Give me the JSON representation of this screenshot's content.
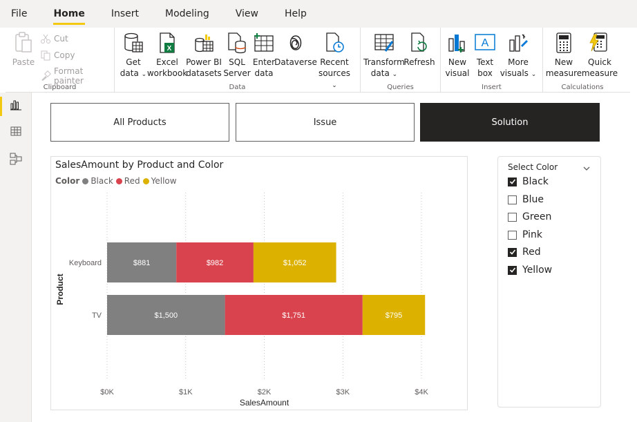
{
  "menu": [
    "File",
    "Home",
    "Insert",
    "Modeling",
    "View",
    "Help"
  ],
  "ribbon": {
    "clipboard": {
      "label": "Clipboard",
      "paste": "Paste",
      "cut": "Cut",
      "copy": "Copy",
      "format_painter": "Format painter"
    },
    "data": {
      "label": "Data",
      "get_data": [
        "Get",
        "data"
      ],
      "excel": [
        "Excel",
        "workbook"
      ],
      "powerbi": [
        "Power BI",
        "datasets"
      ],
      "sql": [
        "SQL",
        "Server"
      ],
      "enter": [
        "Enter",
        "data"
      ],
      "dataverse": [
        "Dataverse",
        ""
      ],
      "recent": [
        "Recent",
        "sources"
      ]
    },
    "queries": {
      "label": "Queries",
      "transform": [
        "Transform",
        "data"
      ],
      "refresh": [
        "Refresh",
        ""
      ]
    },
    "insert": {
      "label": "Insert",
      "new_visual": [
        "New",
        "visual"
      ],
      "text_box": [
        "Text",
        "box"
      ],
      "more_visuals": [
        "More",
        "visuals"
      ]
    },
    "calculations": {
      "label": "Calculations",
      "new_measure": [
        "New",
        "measure"
      ],
      "quick_measure": [
        "Quick",
        "measure"
      ]
    }
  },
  "tabs": [
    {
      "label": "All Products",
      "selected": false
    },
    {
      "label": "Issue",
      "selected": false
    },
    {
      "label": "Solution",
      "selected": true
    }
  ],
  "chart_data": {
    "type": "bar",
    "orientation": "horizontal",
    "stacked": true,
    "title": "SalesAmount by Product and Color",
    "legend_title": "Color",
    "categories": [
      "Keyboard",
      "TV"
    ],
    "series": [
      {
        "name": "Black",
        "color": "#808080",
        "values": [
          881,
          1500
        ],
        "labels": [
          "$881",
          "$1,500"
        ]
      },
      {
        "name": "Red",
        "color": "#d9434e",
        "values": [
          982,
          1751
        ],
        "labels": [
          "$982",
          "$1,751"
        ]
      },
      {
        "name": "Yellow",
        "color": "#dcb100",
        "values": [
          1052,
          795
        ],
        "labels": [
          "$1,052",
          "$795"
        ]
      }
    ],
    "xlabel": "SalesAmount",
    "ylabel": "Product",
    "xlim": [
      0,
      4000
    ],
    "xticks": [
      0,
      1000,
      2000,
      3000,
      4000
    ],
    "xtick_labels": [
      "$0K",
      "$1K",
      "$2K",
      "$3K",
      "$4K"
    ],
    "grid": true,
    "legend_position": "top-left"
  },
  "slicer": {
    "title": "Select Color",
    "items": [
      {
        "label": "Black",
        "checked": true
      },
      {
        "label": "Blue",
        "checked": false
      },
      {
        "label": "Green",
        "checked": false
      },
      {
        "label": "Pink",
        "checked": false
      },
      {
        "label": "Red",
        "checked": true
      },
      {
        "label": "Yellow",
        "checked": true
      }
    ]
  }
}
